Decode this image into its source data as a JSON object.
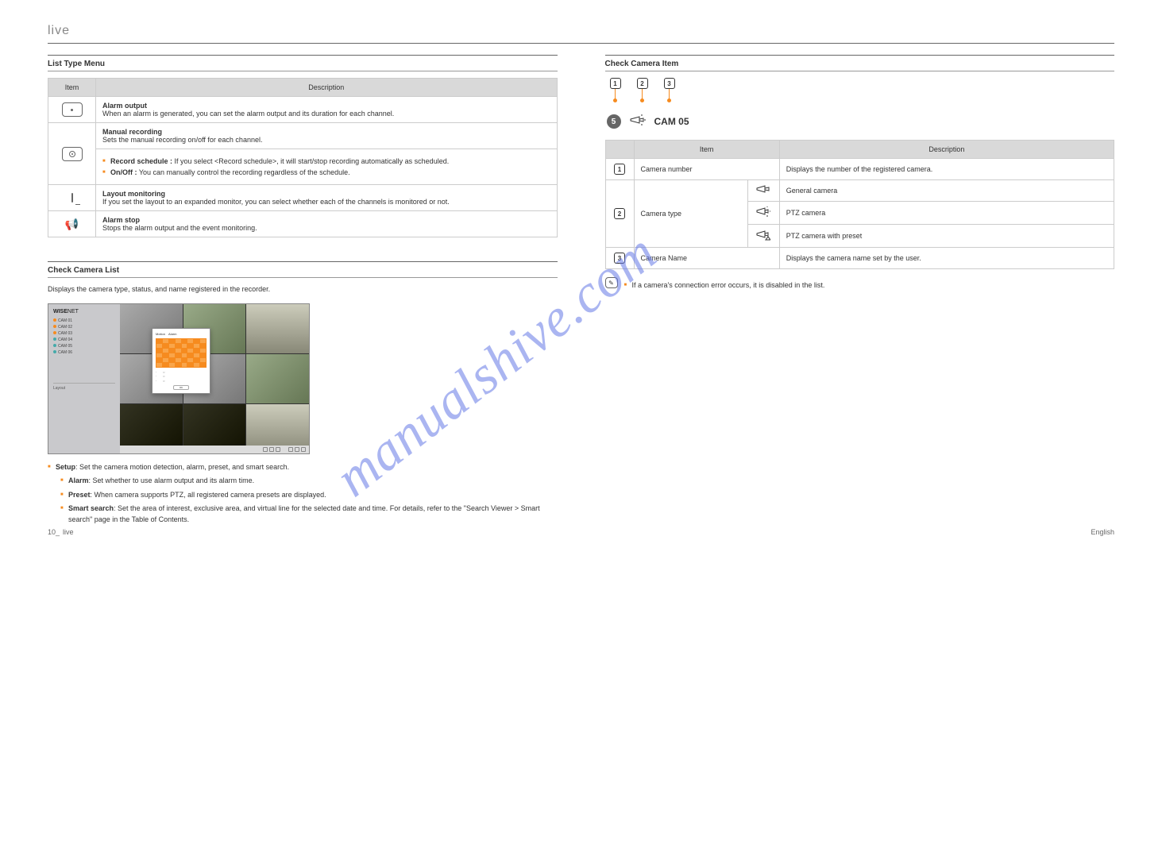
{
  "header": {
    "chapterTitle": "live"
  },
  "left": {
    "listTypeMenu": {
      "heading": "List Type Menu",
      "columns": {
        "item": "Item",
        "description": "Description"
      },
      "rows": [
        {
          "iconName": "button-icon",
          "title": "Alarm output",
          "desc": "When an alarm is generated, you can set the alarm output and its duration for each channel."
        },
        {
          "iconName": "record-target-icon",
          "title": "Manual recording",
          "desc1": "Sets the manual recording on/off for each channel.",
          "desc2Label": "Record schedule :",
          "desc2": " If you select <Record schedule>, it will start/stop recording automatically as scheduled.",
          "desc3Label": "On/Off :",
          "desc3": " You can manually control the recording regardless of the schedule."
        },
        {
          "iconName": "monitor-icon",
          "title": "Layout monitoring",
          "desc": "If you set the layout to an expanded monitor, you can select whether each of the channels is monitored or not."
        },
        {
          "iconName": "speaker-icon",
          "title": "Alarm stop",
          "desc": "Stops the alarm output and the event monitoring."
        }
      ]
    },
    "cameraListSection": {
      "heading": "Check Camera List",
      "intro": "Displays the camera type, status, and name registered in the recorder.",
      "thumbCaption": "",
      "bullets": [
        {
          "label": "Setup",
          "text": ": Set the camera motion detection, alarm, preset, and smart search."
        },
        {
          "label": "Alarm",
          "text": ": Set whether to use alarm output and its alarm time."
        },
        {
          "label": "Preset",
          "text": ": When camera supports PTZ, all registered camera presets are displayed."
        },
        {
          "label": "Smart search",
          "text": ": Set the area of interest, exclusive area, and virtual line for the selected date and time. For details, refer to the \"Search Viewer > Smart search\" page in the Table of Contents."
        }
      ]
    }
  },
  "right": {
    "cameraItemSection": {
      "heading": "Check Camera Item",
      "diagram": {
        "badge": "5",
        "camLabel": "CAM 05"
      },
      "columns": {
        "item": "Item",
        "description": "Description"
      },
      "rows": [
        {
          "num": "1",
          "item": "Camera number",
          "desc": "Displays the number of the registered camera."
        },
        {
          "num": "2",
          "item": "Camera type",
          "sub": [
            {
              "iconName": "camera-plain-icon",
              "desc": "General camera"
            },
            {
              "iconName": "camera-ptz-icon",
              "desc": "PTZ camera"
            },
            {
              "iconName": "camera-ptz-preset-icon",
              "desc": "PTZ camera with preset"
            }
          ]
        },
        {
          "num": "3",
          "item": "Camera Name",
          "desc": "Displays the camera name set by the user."
        }
      ],
      "note": "If a camera's connection error occurs, it is disabled in the list."
    }
  },
  "footer": {
    "pageNum": "10_",
    "pageLabel": "live",
    "right": "English"
  },
  "watermark": "manualshive.com"
}
